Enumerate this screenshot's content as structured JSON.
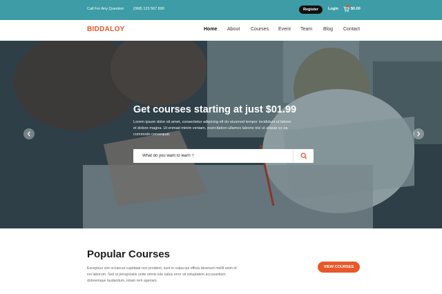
{
  "topbar": {
    "call_text": "Call For Any Question",
    "phone": "(068) 123 567 890",
    "register": "Register",
    "login": "Login",
    "cart_icon": "cart-icon",
    "cart_amount": "$0.00"
  },
  "nav": {
    "logo": "BIDDALOY",
    "items": [
      "Home",
      "About",
      "Courses",
      "Event",
      "Team",
      "Blog",
      "Contact"
    ],
    "active": "Home"
  },
  "hero": {
    "title": "Get courses starting at just $01.99",
    "lead": "Lorem ipsum dolor sit amet, consectetur adipicing elt do eiusmod tempor incididunt ut labore et dolore magna. Ut enmad minim veniam, exercitation ullamco laboris nisi ut aliquip ex ea commodo consequat.",
    "search_placeholder": "What do you want to learn ?",
    "search_icon": "search-icon",
    "prev_icon": "chevron-left-icon",
    "next_icon": "chevron-right-icon"
  },
  "popular": {
    "title": "Popular Courses",
    "description": "Excepteur sint occaecat cupidatat non proident, sunt in culpa qui officia deserunt mollit anim id est laborum. Sed ut perspiciatis unde omnis iste natus error sit voluptatem accusantium doloremque laudantium, totam rem aperiam.",
    "button": "VIEW COURSES"
  },
  "colors": {
    "topbar": "#3d9ca6",
    "accent": "#e8572a",
    "register_bg": "#111111"
  }
}
